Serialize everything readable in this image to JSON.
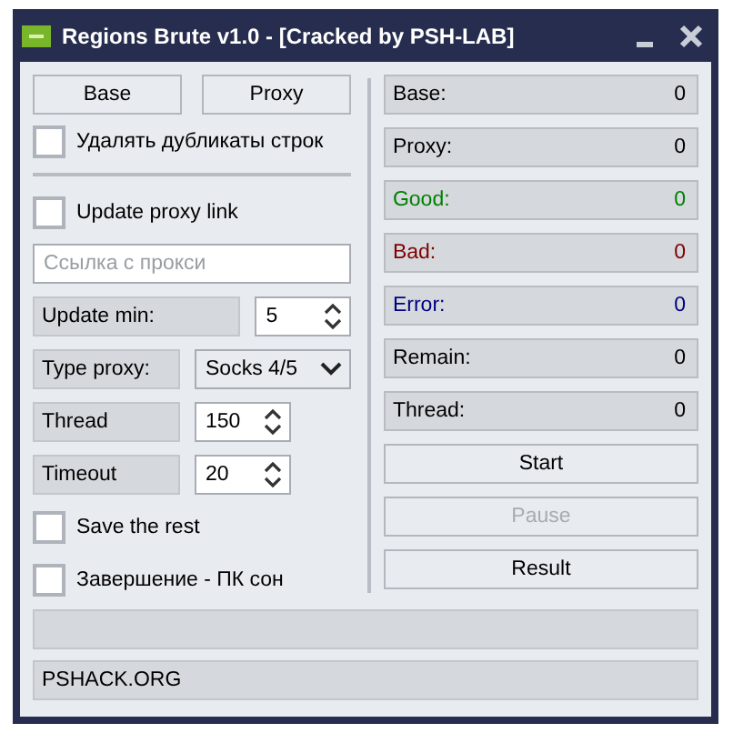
{
  "window": {
    "title": "Regions Brute v1.0 - [Cracked by PSH-LAB]"
  },
  "top_buttons": [
    "Base",
    "Proxy"
  ],
  "remove_duplicates": {
    "label": "Удалять дубликаты строк",
    "checked": false
  },
  "update_proxy_link": {
    "label": "Update proxy link",
    "checked": false
  },
  "proxy_link": {
    "placeholder": "Ссылка с прокси"
  },
  "settings": [
    {
      "kind": "widespin",
      "label": "Update min:",
      "value": "5"
    },
    {
      "kind": "combo",
      "label": "Type proxy:",
      "value": "Socks 4/5"
    },
    {
      "kind": "spin",
      "label": "Thread",
      "value": "150"
    },
    {
      "kind": "spin",
      "label": "Timeout",
      "value": "20"
    }
  ],
  "options": [
    {
      "label": "Save the rest",
      "checked": false
    },
    {
      "label": "Завершение - ПК сон",
      "checked": false
    }
  ],
  "stats": [
    {
      "label": "Base:",
      "value": "0",
      "color": "#000000"
    },
    {
      "label": "Proxy:",
      "value": "0",
      "color": "#000000"
    },
    {
      "label": "Good:",
      "value": "0",
      "color": "#008000"
    },
    {
      "label": "Bad:",
      "value": "0",
      "color": "#800000"
    },
    {
      "label": "Error:",
      "value": "0",
      "color": "#000080"
    },
    {
      "label": "Remain:",
      "value": "0",
      "color": "#000000"
    },
    {
      "label": "Thread:",
      "value": "0",
      "color": "#000000"
    }
  ],
  "actions": [
    {
      "label": "Start",
      "disabled": false
    },
    {
      "label": "Pause",
      "disabled": true
    },
    {
      "label": "Result",
      "disabled": false
    }
  ],
  "footer": "PSHACK.ORG"
}
